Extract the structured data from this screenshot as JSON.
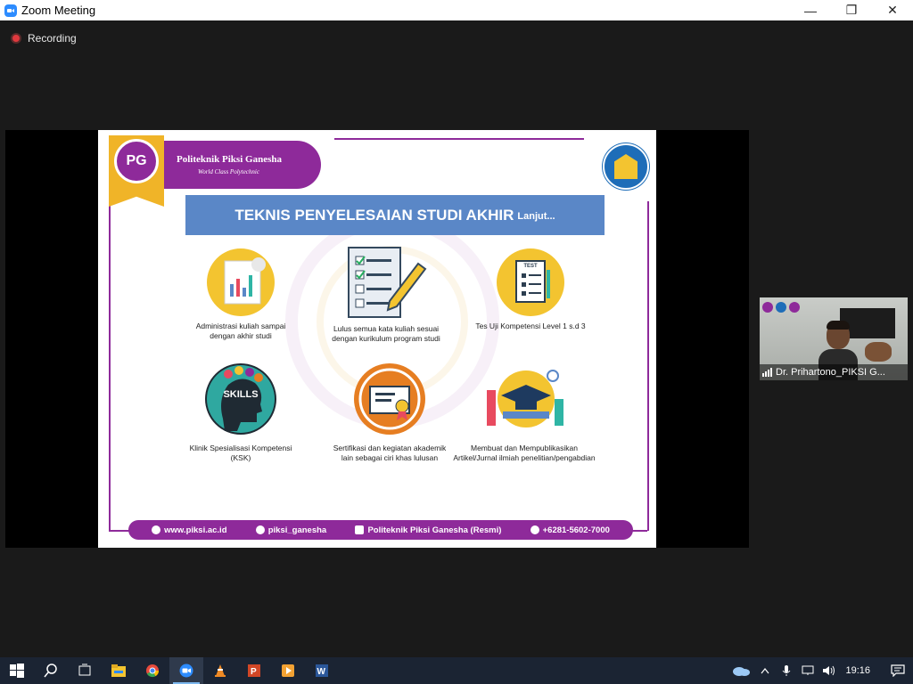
{
  "window": {
    "title": "Zoom Meeting",
    "minimize": "—",
    "maximize": "❐",
    "close": "✕"
  },
  "meeting": {
    "recording_label": "Recording"
  },
  "slide": {
    "brand_name": "Politeknik Piksi Ganesha",
    "brand_tagline": "World Class Polytechnic",
    "heading": "TEKNIS PENYELESAIAN STUDI AKHIR",
    "heading_suffix": "Lanjut...",
    "items": [
      {
        "caption": "Administrasi kuliah sampai dengan akhir studi"
      },
      {
        "caption": "Lulus semua kata kuliah sesuai dengan kurikulum program studi"
      },
      {
        "caption": "Tes Uji Kompetensi Level 1 s.d 3"
      },
      {
        "caption": "Klinik Spesialisasi Kompetensi (KSK)",
        "icon_text": "SKILLS"
      },
      {
        "caption": "Sertifikasi dan kegiatan akademik lain sebagai ciri khas lulusan"
      },
      {
        "caption": "Membuat dan Mempublikasikan Artikel/Jurnal ilmiah penelitian/pengabdian"
      }
    ],
    "test_label": "TEST",
    "footer": {
      "website": "www.piksi.ac.id",
      "instagram": "piksi_ganesha",
      "facebook": "Politeknik Piksi Ganesha (Resmi)",
      "phone": "+6281-5602-7000"
    }
  },
  "participant": {
    "name": "Dr. Prihartono_PIKSI G..."
  },
  "taskbar": {
    "time": "19:16",
    "icons": [
      "windows-start-icon",
      "search-icon",
      "task-view-icon",
      "file-explorer-icon",
      "chrome-icon",
      "zoom-icon",
      "vlc-icon",
      "powerpoint-icon",
      "media-player-icon",
      "word-icon"
    ]
  },
  "colors": {
    "brand_purple": "#8e2a9a",
    "heading_blue": "#5a87c7",
    "brand_gold": "#f0b428",
    "taskbar": "#1b2433"
  }
}
